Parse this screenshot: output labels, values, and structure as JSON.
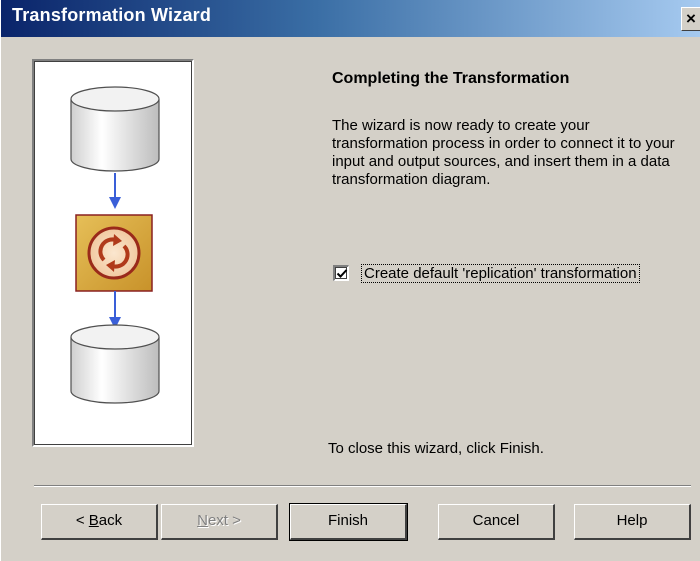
{
  "window": {
    "title": "Transformation Wizard",
    "close_glyph": "×"
  },
  "illustration": {
    "icons": [
      "database-cylinder-icon",
      "transformation-process-icon",
      "database-cylinder-icon"
    ],
    "arrow_color": "#3a5fd8",
    "process_color": "#d4a53a"
  },
  "content": {
    "heading": "Completing the Transformation",
    "description": "The wizard is now ready to create your transformation process in order to connect it to your input and output sources, and insert them in a data transformation diagram.",
    "checkbox_label": "Create default 'replication' transformation",
    "checkbox_checked": true,
    "footer": "To close this wizard, click Finish."
  },
  "buttons": {
    "back_pre": "< ",
    "back_key": "B",
    "back_post": "ack",
    "next_key": "N",
    "next_post": "ext >",
    "finish": "Finish",
    "cancel": "Cancel",
    "help": "Help"
  }
}
